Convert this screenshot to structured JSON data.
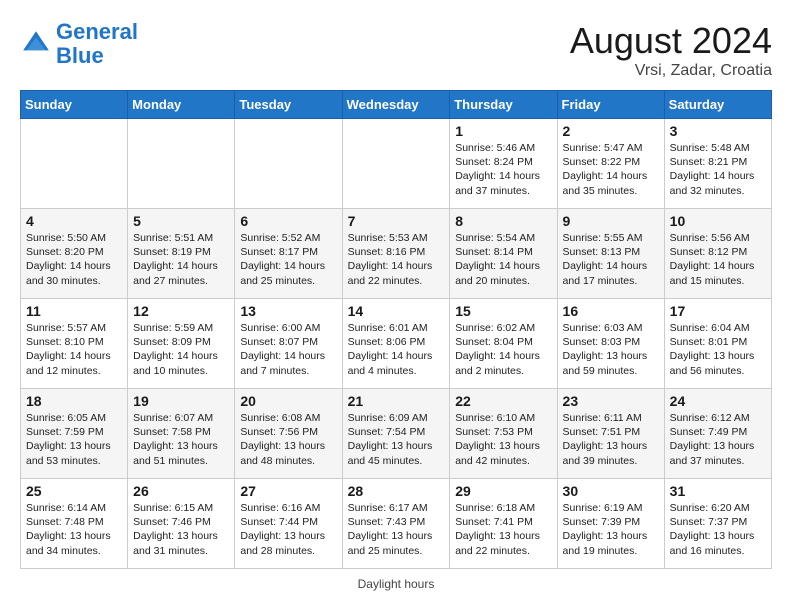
{
  "header": {
    "logo_line1": "General",
    "logo_line2": "Blue",
    "month_year": "August 2024",
    "location": "Vrsi, Zadar, Croatia"
  },
  "days_of_week": [
    "Sunday",
    "Monday",
    "Tuesday",
    "Wednesday",
    "Thursday",
    "Friday",
    "Saturday"
  ],
  "weeks": [
    [
      {
        "day": "",
        "info": ""
      },
      {
        "day": "",
        "info": ""
      },
      {
        "day": "",
        "info": ""
      },
      {
        "day": "",
        "info": ""
      },
      {
        "day": "1",
        "info": "Sunrise: 5:46 AM\nSunset: 8:24 PM\nDaylight: 14 hours and 37 minutes."
      },
      {
        "day": "2",
        "info": "Sunrise: 5:47 AM\nSunset: 8:22 PM\nDaylight: 14 hours and 35 minutes."
      },
      {
        "day": "3",
        "info": "Sunrise: 5:48 AM\nSunset: 8:21 PM\nDaylight: 14 hours and 32 minutes."
      }
    ],
    [
      {
        "day": "4",
        "info": "Sunrise: 5:50 AM\nSunset: 8:20 PM\nDaylight: 14 hours and 30 minutes."
      },
      {
        "day": "5",
        "info": "Sunrise: 5:51 AM\nSunset: 8:19 PM\nDaylight: 14 hours and 27 minutes."
      },
      {
        "day": "6",
        "info": "Sunrise: 5:52 AM\nSunset: 8:17 PM\nDaylight: 14 hours and 25 minutes."
      },
      {
        "day": "7",
        "info": "Sunrise: 5:53 AM\nSunset: 8:16 PM\nDaylight: 14 hours and 22 minutes."
      },
      {
        "day": "8",
        "info": "Sunrise: 5:54 AM\nSunset: 8:14 PM\nDaylight: 14 hours and 20 minutes."
      },
      {
        "day": "9",
        "info": "Sunrise: 5:55 AM\nSunset: 8:13 PM\nDaylight: 14 hours and 17 minutes."
      },
      {
        "day": "10",
        "info": "Sunrise: 5:56 AM\nSunset: 8:12 PM\nDaylight: 14 hours and 15 minutes."
      }
    ],
    [
      {
        "day": "11",
        "info": "Sunrise: 5:57 AM\nSunset: 8:10 PM\nDaylight: 14 hours and 12 minutes."
      },
      {
        "day": "12",
        "info": "Sunrise: 5:59 AM\nSunset: 8:09 PM\nDaylight: 14 hours and 10 minutes."
      },
      {
        "day": "13",
        "info": "Sunrise: 6:00 AM\nSunset: 8:07 PM\nDaylight: 14 hours and 7 minutes."
      },
      {
        "day": "14",
        "info": "Sunrise: 6:01 AM\nSunset: 8:06 PM\nDaylight: 14 hours and 4 minutes."
      },
      {
        "day": "15",
        "info": "Sunrise: 6:02 AM\nSunset: 8:04 PM\nDaylight: 14 hours and 2 minutes."
      },
      {
        "day": "16",
        "info": "Sunrise: 6:03 AM\nSunset: 8:03 PM\nDaylight: 13 hours and 59 minutes."
      },
      {
        "day": "17",
        "info": "Sunrise: 6:04 AM\nSunset: 8:01 PM\nDaylight: 13 hours and 56 minutes."
      }
    ],
    [
      {
        "day": "18",
        "info": "Sunrise: 6:05 AM\nSunset: 7:59 PM\nDaylight: 13 hours and 53 minutes."
      },
      {
        "day": "19",
        "info": "Sunrise: 6:07 AM\nSunset: 7:58 PM\nDaylight: 13 hours and 51 minutes."
      },
      {
        "day": "20",
        "info": "Sunrise: 6:08 AM\nSunset: 7:56 PM\nDaylight: 13 hours and 48 minutes."
      },
      {
        "day": "21",
        "info": "Sunrise: 6:09 AM\nSunset: 7:54 PM\nDaylight: 13 hours and 45 minutes."
      },
      {
        "day": "22",
        "info": "Sunrise: 6:10 AM\nSunset: 7:53 PM\nDaylight: 13 hours and 42 minutes."
      },
      {
        "day": "23",
        "info": "Sunrise: 6:11 AM\nSunset: 7:51 PM\nDaylight: 13 hours and 39 minutes."
      },
      {
        "day": "24",
        "info": "Sunrise: 6:12 AM\nSunset: 7:49 PM\nDaylight: 13 hours and 37 minutes."
      }
    ],
    [
      {
        "day": "25",
        "info": "Sunrise: 6:14 AM\nSunset: 7:48 PM\nDaylight: 13 hours and 34 minutes."
      },
      {
        "day": "26",
        "info": "Sunrise: 6:15 AM\nSunset: 7:46 PM\nDaylight: 13 hours and 31 minutes."
      },
      {
        "day": "27",
        "info": "Sunrise: 6:16 AM\nSunset: 7:44 PM\nDaylight: 13 hours and 28 minutes."
      },
      {
        "day": "28",
        "info": "Sunrise: 6:17 AM\nSunset: 7:43 PM\nDaylight: 13 hours and 25 minutes."
      },
      {
        "day": "29",
        "info": "Sunrise: 6:18 AM\nSunset: 7:41 PM\nDaylight: 13 hours and 22 minutes."
      },
      {
        "day": "30",
        "info": "Sunrise: 6:19 AM\nSunset: 7:39 PM\nDaylight: 13 hours and 19 minutes."
      },
      {
        "day": "31",
        "info": "Sunrise: 6:20 AM\nSunset: 7:37 PM\nDaylight: 13 hours and 16 minutes."
      }
    ]
  ],
  "footer": {
    "note": "Daylight hours"
  }
}
